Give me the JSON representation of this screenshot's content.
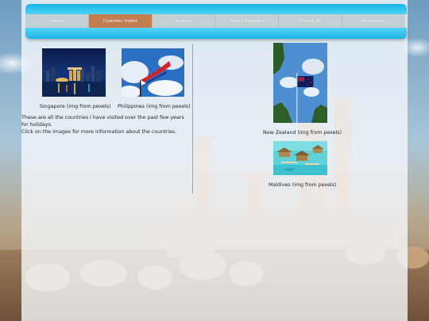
{
  "nav": {
    "items": [
      {
        "label": "About",
        "active": false
      },
      {
        "label": "Countries Visited",
        "active": true
      },
      {
        "label": "Hobbies",
        "active": false
      },
      {
        "label": "Family Members",
        "active": false
      },
      {
        "label": "Contact Me",
        "active": false
      },
      {
        "label": "References",
        "active": false
      }
    ]
  },
  "countries": {
    "singapore": {
      "caption": "Singapore (img from pexels)"
    },
    "philippines": {
      "caption": "Philippines (img from pexels)"
    },
    "new_zealand": {
      "caption": "New Zealand (img from pexels)"
    },
    "maldives": {
      "caption": "Maldives (img from pexels)"
    }
  },
  "intro": {
    "line1": "These are all the countries I have visited over the past few years for holidays.",
    "line2": "Click on the images for more information about the countries."
  },
  "colors": {
    "nav_gradient": "#16b6e8",
    "active_tab": "#c47d4e",
    "nav_item": "#c2d0d4"
  }
}
